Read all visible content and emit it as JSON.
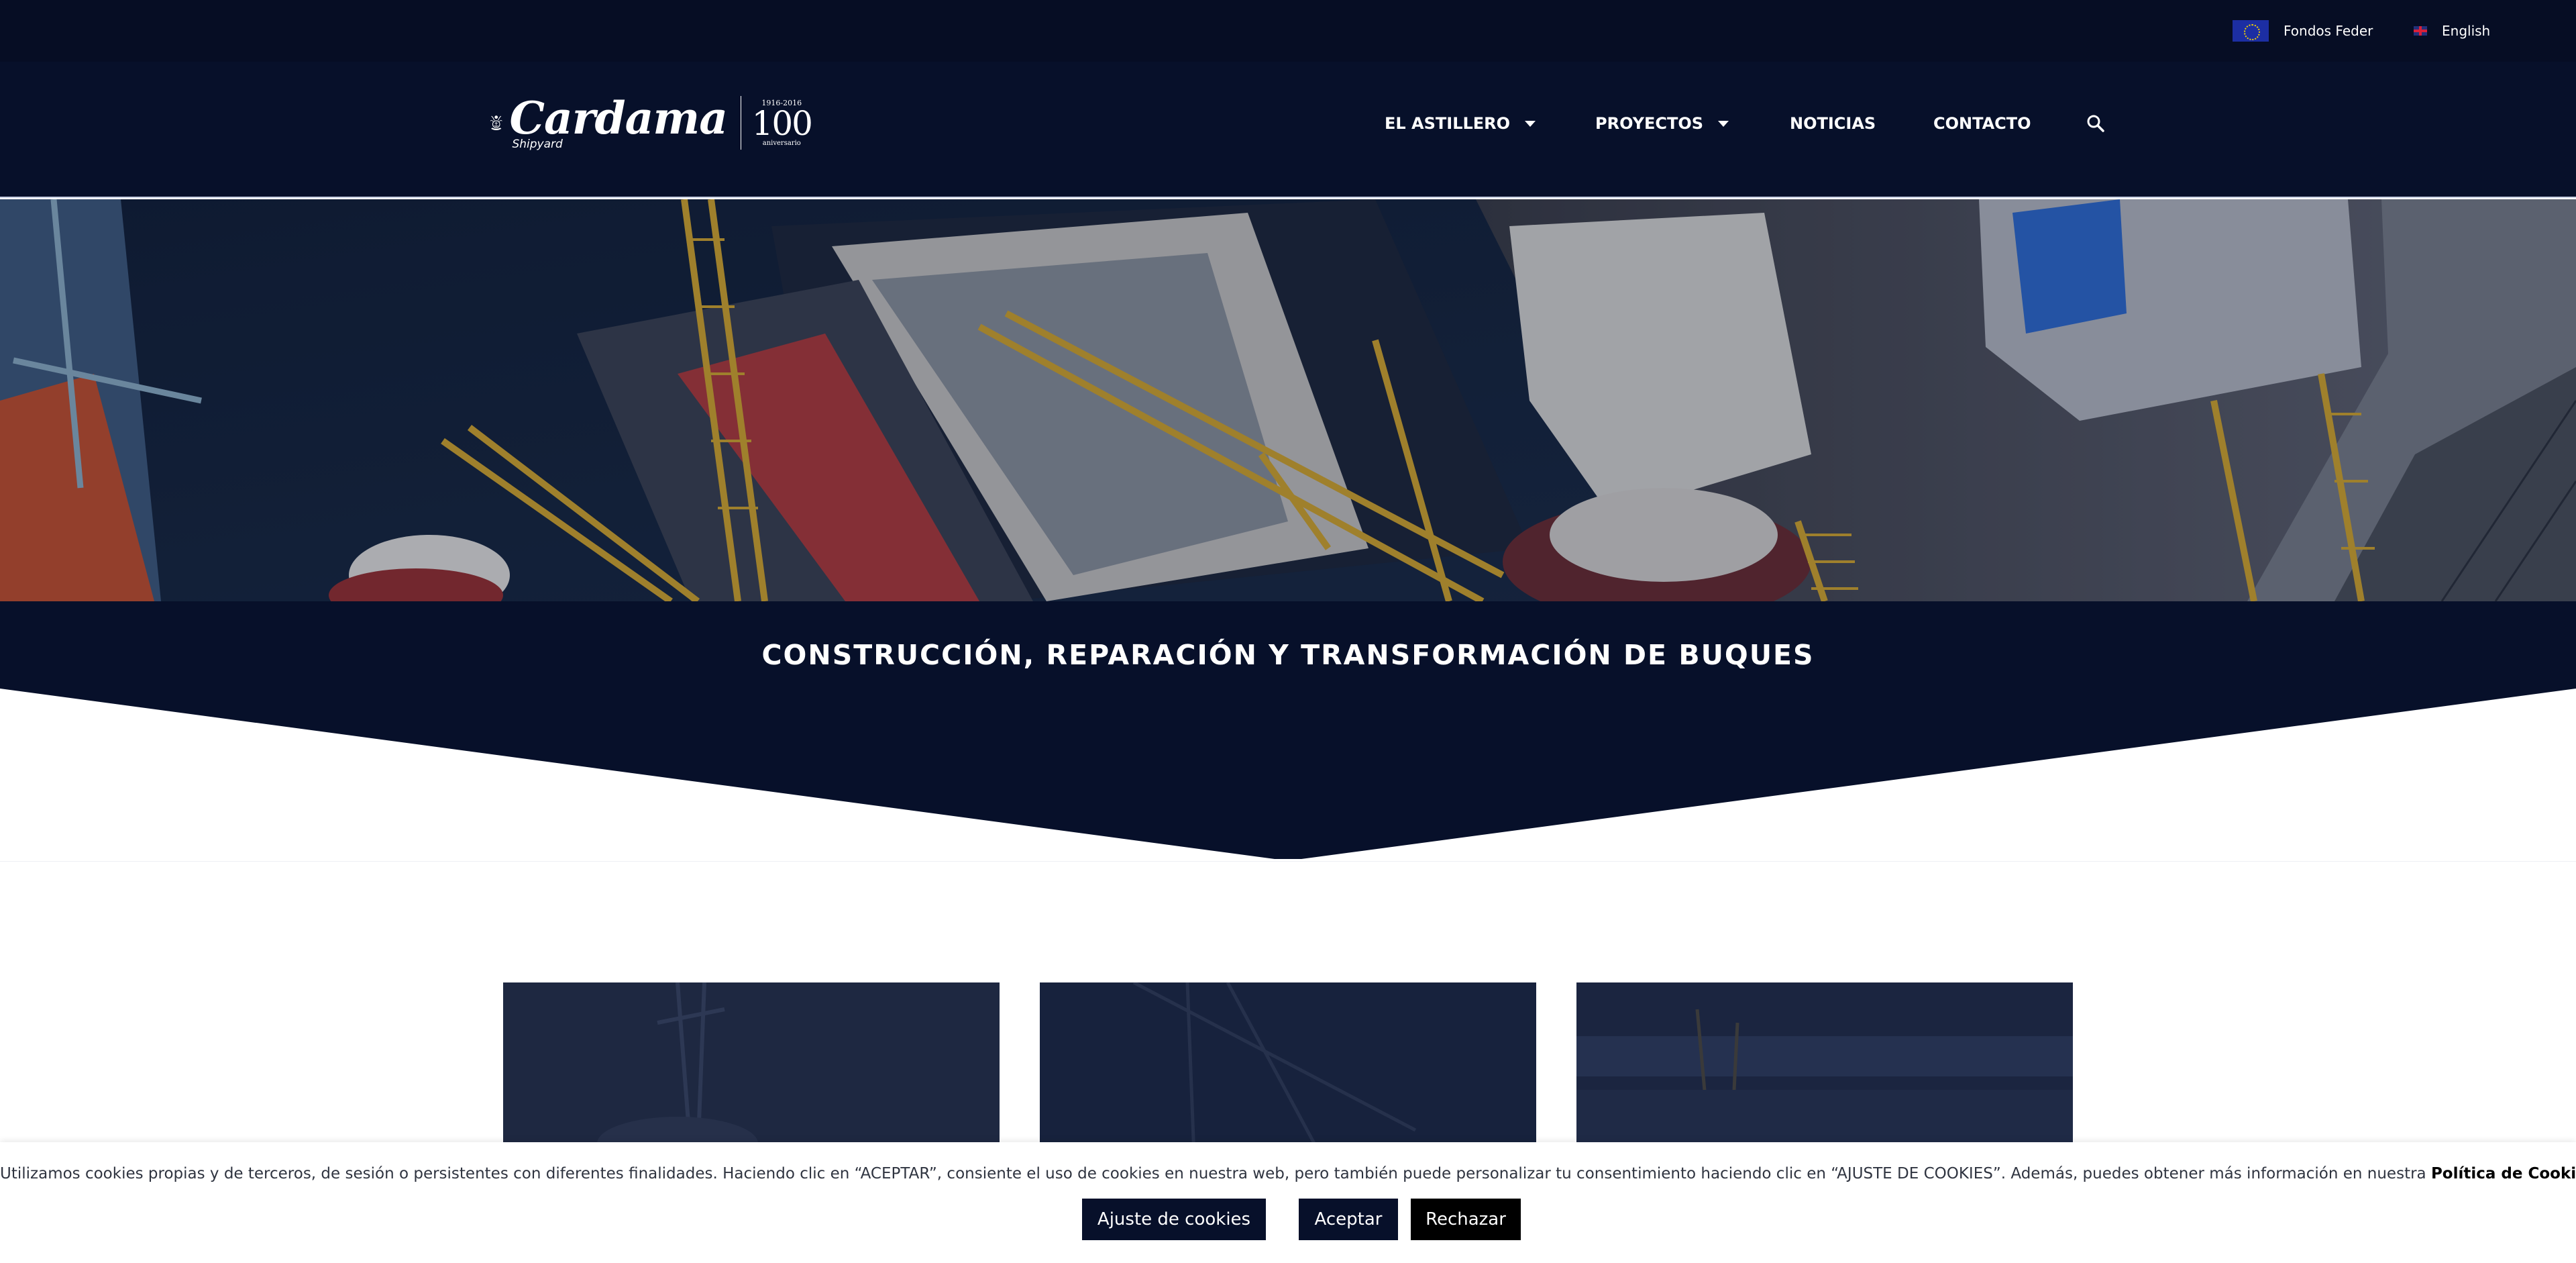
{
  "topbar": {
    "feder_label": "Fondos Feder",
    "language_label": "English"
  },
  "logo": {
    "name": "Cardama",
    "tagline": "Shipyard",
    "anniversary_years": "1916-2016",
    "anniversary_number": "100",
    "anniversary_word": "aniversario"
  },
  "nav": {
    "items": [
      {
        "label": "EL ASTILLERO",
        "has_dropdown": true
      },
      {
        "label": "PROYECTOS",
        "has_dropdown": true
      },
      {
        "label": "NOTICIAS",
        "has_dropdown": false
      },
      {
        "label": "CONTACTO",
        "has_dropdown": false
      }
    ],
    "search_icon": "search-icon"
  },
  "hero": {
    "title": "CONSTRUCCIÓN, REPARACIÓN Y TRANSFORMACIÓN DE BUQUES"
  },
  "cookie": {
    "message": "Utilizamos cookies propias y de terceros, de sesión o persistentes con diferentes finalidades. Haciendo clic en “ACEPTAR”, consiente el uso de cookies en nuestra web, pero también puede personalizar tu consentimiento haciendo clic en “AJUSTE DE COOKIES”. Además, puedes obtener más información en nuestra ",
    "policy_link": "Política de Cookies",
    "trailing": ".",
    "settings_label": "Ajuste de cookies",
    "accept_label": "Aceptar",
    "reject_label": "Rechazar"
  },
  "colors": {
    "navy": "#07102a",
    "topbar": "#060d24",
    "eu_blue": "#1c2ea3"
  }
}
